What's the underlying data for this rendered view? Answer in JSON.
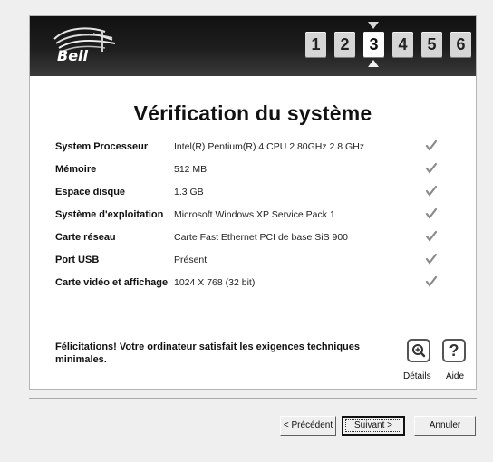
{
  "brand": {
    "name": "Bell"
  },
  "steps": [
    {
      "label": "1",
      "active": false
    },
    {
      "label": "2",
      "active": false
    },
    {
      "label": "3",
      "active": true
    },
    {
      "label": "4",
      "active": false
    },
    {
      "label": "5",
      "active": false
    },
    {
      "label": "6",
      "active": false
    }
  ],
  "page": {
    "title": "Vérification du système"
  },
  "system_info": [
    {
      "label": "System Processeur",
      "value": "Intel(R) Pentium(R) 4 CPU 2.80GHz 2.8 GHz",
      "status_icon": "checkmark-icon"
    },
    {
      "label": "Mémoire",
      "value": "512 MB",
      "status_icon": "checkmark-icon"
    },
    {
      "label": "Espace disque",
      "value": "1.3 GB",
      "status_icon": "checkmark-icon"
    },
    {
      "label": "Système d'exploitation",
      "value": "Microsoft Windows XP Service Pack 1",
      "status_icon": "checkmark-icon"
    },
    {
      "label": "Carte réseau",
      "value": "Carte Fast Ethernet PCI de base SiS 900",
      "status_icon": "checkmark-icon"
    },
    {
      "label": "Port USB",
      "value": "Présent",
      "status_icon": "checkmark-icon"
    },
    {
      "label": "Carte vidéo et affichage",
      "value": "1024 X 768 (32 bit)",
      "status_icon": "checkmark-icon"
    }
  ],
  "footer": {
    "message": "Félicitations! Votre ordinateur satisfait les exigences techniques minimales.",
    "details_label": "Détails",
    "details_icon": "magnifier-plus-icon",
    "help_label": "Aide",
    "help_icon": "question-mark-icon",
    "help_glyph": "?"
  },
  "buttons": {
    "previous": "< Précédent",
    "next": "Suivant >",
    "cancel": "Annuler"
  },
  "colors": {
    "header_bg": "#111111",
    "step_bg": "#d6d6d6",
    "active_step_bg": "#fefefe",
    "panel_bg": "#ffffff",
    "window_bg": "#efefef"
  }
}
